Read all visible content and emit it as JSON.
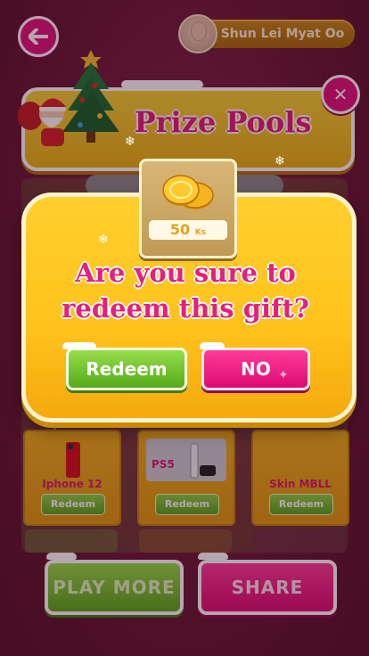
{
  "header": {
    "user_name": "Shun Lei Myat Oo",
    "title": "Prize Pools"
  },
  "prizes": [
    {
      "name": "Iphone 12",
      "button": "Redeem"
    },
    {
      "name": "PS5",
      "button": "Redeem"
    },
    {
      "name": "Skin MBLL",
      "button": "Redeem"
    }
  ],
  "bottom_buttons": {
    "play_more": "PLAY MORE",
    "share": "SHARE"
  },
  "dialog": {
    "gift_value": "50",
    "gift_unit": "Ks",
    "question": "Are you sure to redeem this gift?",
    "confirm": "Redeem",
    "cancel": "NO"
  },
  "colors": {
    "accent_pink": "#e5207a",
    "popup_yellow": "#ffc21c",
    "green_button": "#5aab1f"
  },
  "icons": {
    "back": "arrow-left-icon",
    "close": "close-x-icon",
    "coins": "gold-coins-icon"
  }
}
